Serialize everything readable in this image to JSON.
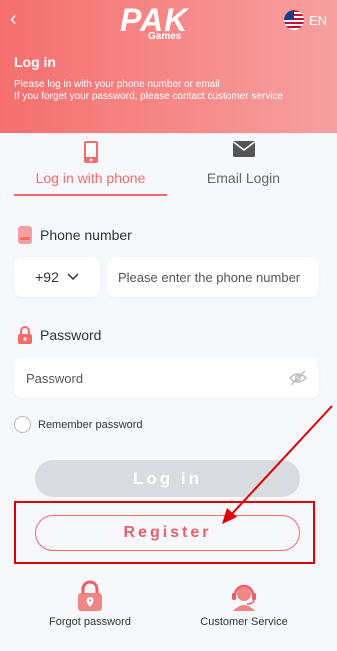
{
  "header": {
    "back_label": "‹",
    "logo_main": "PAK",
    "logo_sub": "Games",
    "language": "EN",
    "title": "Log in",
    "subtitle_line1": "Please log in with your phone number or email",
    "subtitle_line2": "If you forget your password, please contact customer service"
  },
  "tabs": [
    {
      "label": "Log in with phone",
      "icon": "phone-icon",
      "active": true
    },
    {
      "label": "Email Login",
      "icon": "mail-icon",
      "active": false
    }
  ],
  "phone": {
    "label": "Phone number",
    "country_code": "+92",
    "placeholder": "Please enter the phone number"
  },
  "password": {
    "label": "Password",
    "placeholder": "Password"
  },
  "remember_label": "Remember password",
  "login_label": "Log in",
  "register_label": "Register",
  "bottom": {
    "forgot_label": "Forgot password",
    "service_label": "Customer Service"
  },
  "colors": {
    "accent": "#f56a6a",
    "header_start": "#f56f6f",
    "header_end": "#f7a0a0",
    "login_disabled": "#d9dbe1",
    "annotation": "#e00000"
  }
}
